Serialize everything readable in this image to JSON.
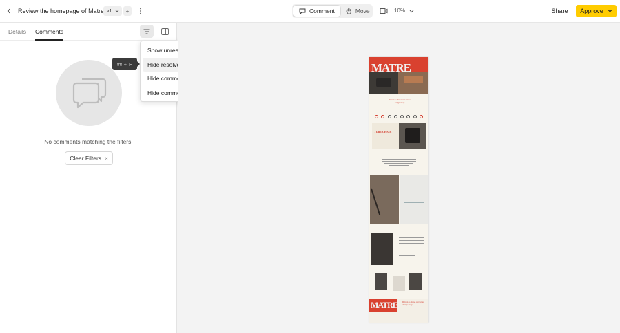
{
  "header": {
    "title": "Review the homepage of Matre",
    "version": "v1",
    "add_version": "+",
    "mode_comment": "Comment",
    "mode_move": "Move",
    "zoom": "10%",
    "share": "Share",
    "approve": "Approve"
  },
  "sidebar": {
    "tabs": [
      {
        "label": "Details"
      },
      {
        "label": "Comments"
      }
    ],
    "empty_text": "No comments matching the filters.",
    "clear_filters": "Clear Filters",
    "clear_filters_x": "×"
  },
  "tooltip": {
    "shortcut_plus": "+",
    "shortcut_key": "H"
  },
  "filter_menu": {
    "items": [
      {
        "label": "Show unread comments only",
        "checked": true
      },
      {
        "label": "Hide resolved comments",
        "checked": false
      },
      {
        "label": "Hide comments on other versions",
        "checked": false
      },
      {
        "label": "Hide comment bubbles",
        "checked": false
      }
    ]
  },
  "preview": {
    "brand": "MATRE",
    "brand_bottom": "MATRE",
    "tagline": "Driven to shape our future design story",
    "tagline_bottom": "Driven to shape our future design story",
    "section_label": "TUBE CHAIR",
    "accent_color": "#d33a2c"
  },
  "colors": {
    "approve_bg": "#ffcc00"
  }
}
